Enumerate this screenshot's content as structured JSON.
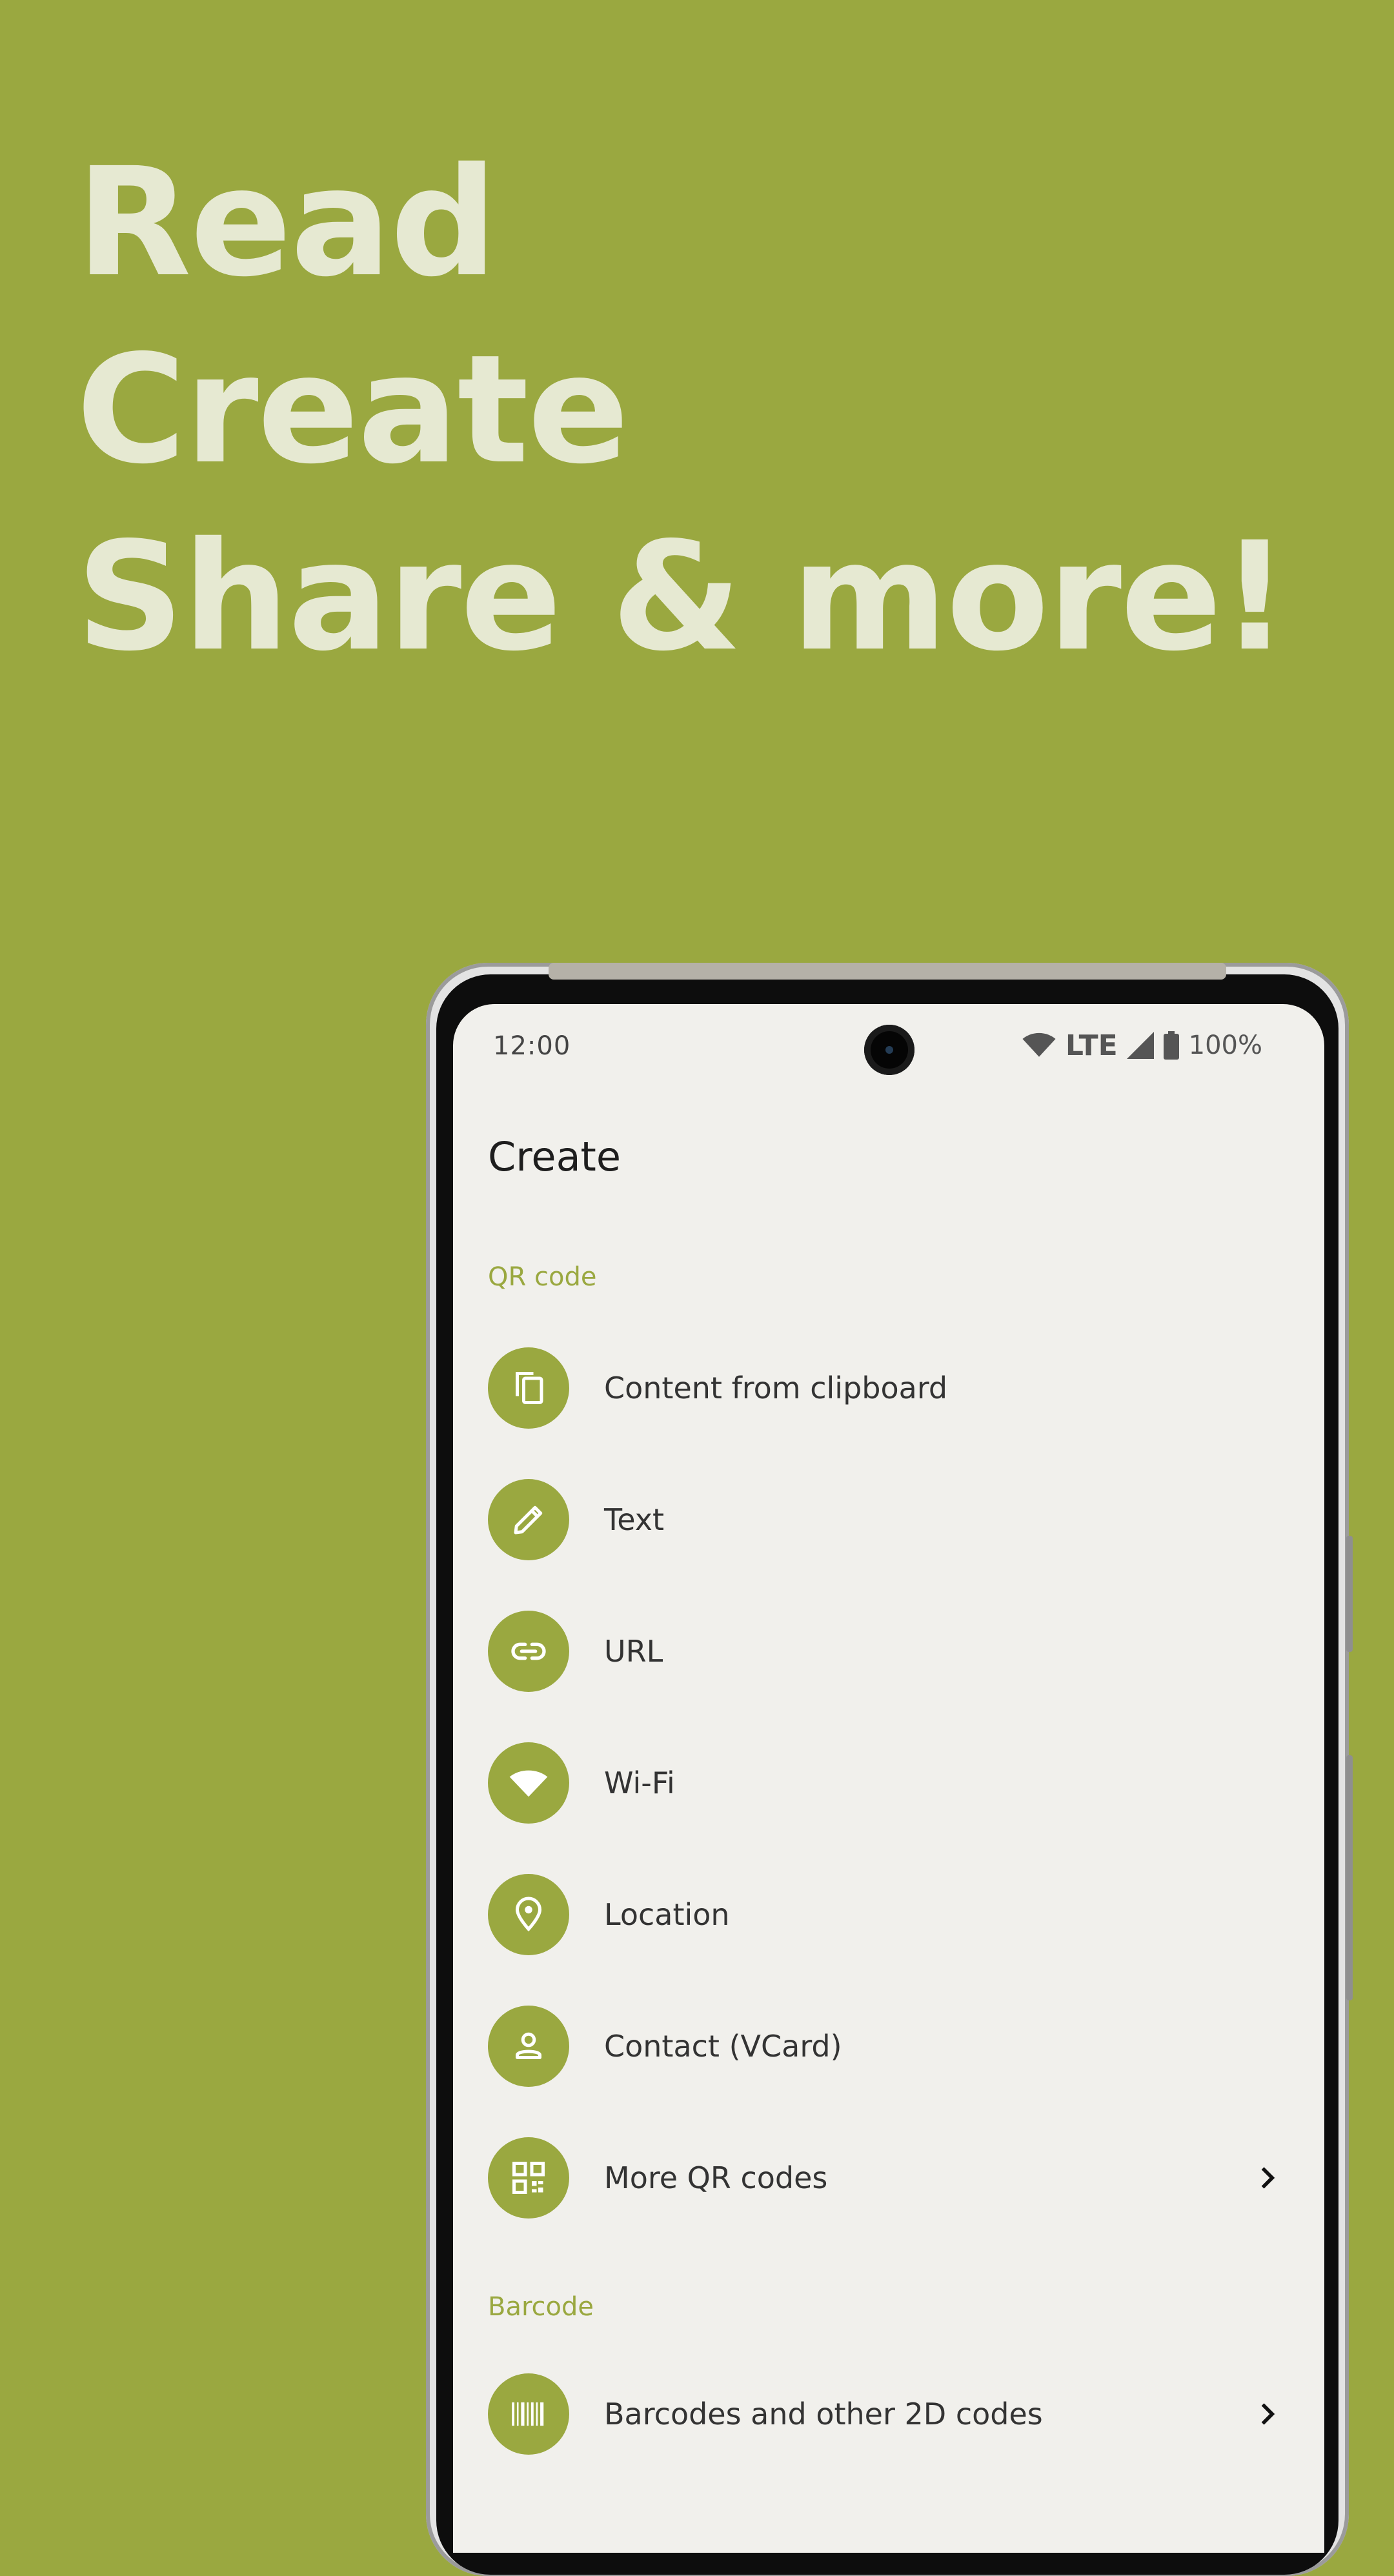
{
  "hero": {
    "lines": [
      "Read",
      "Create",
      "Share & more!"
    ]
  },
  "status_bar": {
    "time": "12:00",
    "network": "LTE",
    "battery": "100%"
  },
  "page": {
    "title": "Create"
  },
  "sections": {
    "qr": {
      "header": "QR code",
      "items": [
        {
          "label": "Content from clipboard",
          "icon": "clipboard-icon"
        },
        {
          "label": "Text",
          "icon": "pencil-icon"
        },
        {
          "label": "URL",
          "icon": "link-icon"
        },
        {
          "label": "Wi-Fi",
          "icon": "wifi-icon"
        },
        {
          "label": "Location",
          "icon": "location-pin-icon"
        },
        {
          "label": "Contact (VCard)",
          "icon": "person-icon"
        },
        {
          "label": "More QR codes",
          "icon": "qr-code-icon"
        }
      ]
    },
    "barcode": {
      "header": "Barcode",
      "items": [
        {
          "label": "Barcodes and other 2D codes",
          "icon": "barcode-icon"
        }
      ]
    }
  },
  "colors": {
    "background": "#9aa840",
    "accent": "#9aa840",
    "hero_text": "#e6e9d2",
    "screen": "#f1f0ec"
  }
}
